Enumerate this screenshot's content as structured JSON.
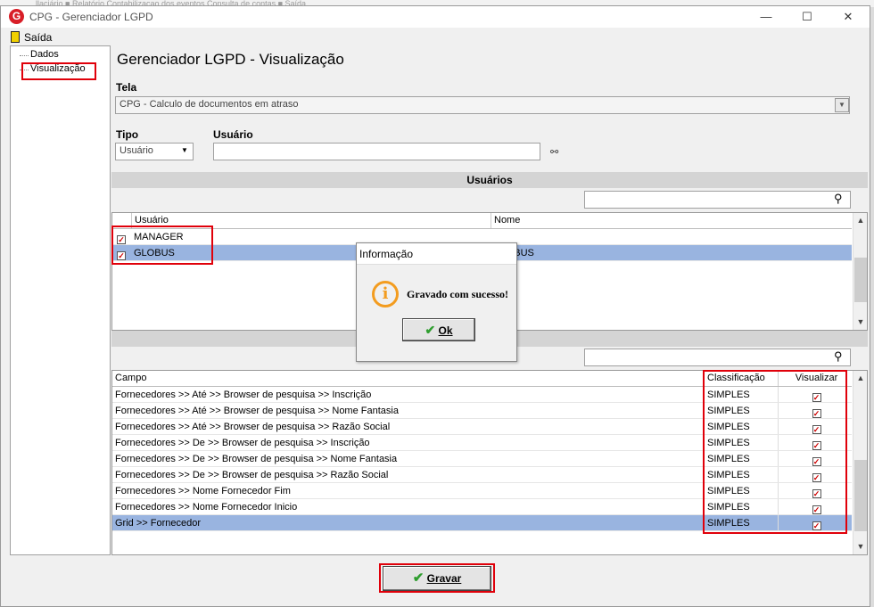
{
  "background_strip": "llaciário  ■  Relatório  Contabilizaçao dos eventos  Consulta de contas  ■  Saída",
  "window": {
    "title": "CPG - Gerenciador LGPD",
    "logo": "G",
    "controls": {
      "minimize": "—",
      "maximize": "☐",
      "close": "✕"
    }
  },
  "menu": {
    "exit_label": "Saída"
  },
  "tree": {
    "items": [
      "Dados",
      "Visualização"
    ]
  },
  "page_title": "Gerenciador LGPD - Visualização",
  "tela": {
    "label": "Tela",
    "value": "CPG - Calculo de documentos em atraso"
  },
  "tipo": {
    "label": "Tipo",
    "value": "Usuário"
  },
  "usuario": {
    "label": "Usuário",
    "value": ""
  },
  "users_section": {
    "title": "Usuários",
    "columns": [
      "Usuário",
      "Nome"
    ],
    "rows": [
      {
        "usuario": "MANAGER",
        "nome": "",
        "checked": true,
        "selected": false
      },
      {
        "usuario": "GLOBUS",
        "nome": "GLOBUS",
        "checked": true,
        "selected": true
      }
    ]
  },
  "fields_section": {
    "title": "Campo",
    "columns": [
      "Campo",
      "Classificação",
      "Visualizar"
    ],
    "rows": [
      {
        "campo": "Fornecedores >> Até >> Browser de pesquisa >> Inscrição",
        "classificacao": "SIMPLES",
        "visualizar": true
      },
      {
        "campo": "Fornecedores >> Até >> Browser de pesquisa >> Nome Fantasia",
        "classificacao": "SIMPLES",
        "visualizar": true
      },
      {
        "campo": "Fornecedores >> Até >> Browser de pesquisa >> Razão Social",
        "classificacao": "SIMPLES",
        "visualizar": true
      },
      {
        "campo": "Fornecedores >> De >> Browser de pesquisa >> Inscrição",
        "classificacao": "SIMPLES",
        "visualizar": true
      },
      {
        "campo": "Fornecedores >> De >> Browser de pesquisa >> Nome Fantasia",
        "classificacao": "SIMPLES",
        "visualizar": true
      },
      {
        "campo": "Fornecedores >> De >> Browser de pesquisa >> Razão Social",
        "classificacao": "SIMPLES",
        "visualizar": true
      },
      {
        "campo": "Fornecedores >> Nome Fornecedor Fim",
        "classificacao": "SIMPLES",
        "visualizar": true
      },
      {
        "campo": "Fornecedores >> Nome Fornecedor Inicio",
        "classificacao": "SIMPLES",
        "visualizar": true
      },
      {
        "campo": "Grid >> Fornecedor",
        "classificacao": "SIMPLES",
        "visualizar": true,
        "selected": true
      }
    ]
  },
  "save_button": {
    "label": "Gravar"
  },
  "dialog": {
    "title": "Informação",
    "message": "Gravado com sucesso!",
    "ok_label": "Ok"
  },
  "colors": {
    "highlight_border": "#e0000a",
    "selection": "#99b4e0",
    "check": "#cc0000",
    "info_icon": "#f39c1f",
    "logo": "#d81e27"
  }
}
